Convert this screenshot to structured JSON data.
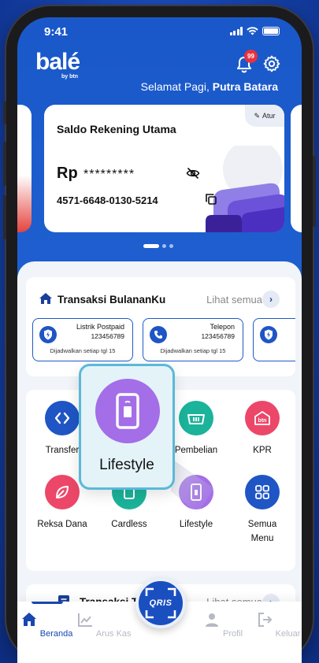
{
  "status_bar": {
    "time": "9:41"
  },
  "brand": {
    "logo": "balé",
    "sub": "by btn",
    "notification_count": "99"
  },
  "greeting": {
    "prefix": "Selamat Pagi,",
    "name": "Putra Batara"
  },
  "account_card": {
    "title": "Saldo Rekening Utama",
    "setting_label": "Atur",
    "currency": "Rp",
    "masked_balance": "*********",
    "account_number": "4571-6648-0130-5214"
  },
  "monthly": {
    "title": "Transaksi BulananKu",
    "see_all": "Lihat semua",
    "bills": [
      {
        "name": "Listrik Postpaid",
        "number": "123456789",
        "schedule": "Dijadwalkan setiap tgl 15",
        "icon": "lightning-shield-icon"
      },
      {
        "name": "Telepon",
        "number": "123456789",
        "schedule": "Dijadwalkan setiap tgl 15",
        "icon": "phone-icon"
      }
    ]
  },
  "menu": {
    "items": [
      {
        "label": "Transfer",
        "icon": "transfer-icon",
        "color": "#1f55c4"
      },
      {
        "label": "Pembelian",
        "icon": "basket-icon",
        "color": "#1bb39a"
      },
      {
        "label": "KPR",
        "icon": "btn-house-icon",
        "color": "#ec4769"
      },
      {
        "label": "Reksa Dana",
        "icon": "leaf-icon",
        "color": "#ec4769"
      },
      {
        "label": "Cardless",
        "icon": "cardless-icon",
        "color": "#1bb39a"
      },
      {
        "label": "Lifestyle",
        "icon": "smartphone-icon",
        "color": "#a36ee7"
      },
      {
        "label": "Semua",
        "label2": "Menu",
        "icon": "grid-icon",
        "color": "#1f55c4"
      }
    ],
    "highlight_label": "Lifestyle"
  },
  "recent": {
    "title": "Transaksi Terakhir",
    "see_all": "Lihat semua"
  },
  "nav": {
    "items": [
      {
        "label": "Beranda",
        "icon": "home-icon"
      },
      {
        "label": "Arus Kas",
        "icon": "chart-icon"
      },
      {
        "label": "Profil",
        "icon": "user-icon"
      },
      {
        "label": "Keluar",
        "icon": "logout-icon"
      }
    ],
    "qris_label": "QRIS"
  }
}
